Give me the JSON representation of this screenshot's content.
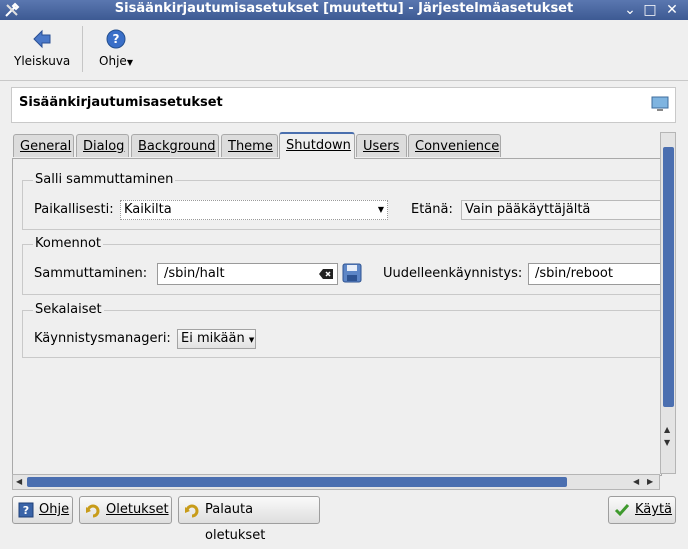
{
  "window": {
    "title": "Sisäänkirjautumisasetukset [muutettu] - Järjestelmäasetukset",
    "minimize_glyph": "⌄",
    "maximize_glyph": "□",
    "close_glyph": "✕"
  },
  "toolbar": {
    "overview_label": "Yleiskuva",
    "help_label": "Ohje"
  },
  "header": {
    "title": "Sisäänkirjautumisasetukset"
  },
  "tabs": [
    {
      "label": "General"
    },
    {
      "label": "Dialog"
    },
    {
      "label": "Background"
    },
    {
      "label": "Theme"
    },
    {
      "label": "Shutdown"
    },
    {
      "label": "Users"
    },
    {
      "label": "Convenience"
    }
  ],
  "active_tab": "Shutdown",
  "shutdown": {
    "allow_group_title": "Salli sammuttaminen",
    "local_label": "Paikallisesti:",
    "local_value": "Kaikilta",
    "remote_label": "Etänä:",
    "remote_value": "Vain pääkäyttäjältä",
    "commands_group_title": "Komennot",
    "halt_label": "Sammuttaminen:",
    "halt_value": "/sbin/halt",
    "reboot_label": "Uudelleenkäynnistys:",
    "reboot_value": "/sbin/reboot",
    "misc_group_title": "Sekalaiset",
    "bootmgr_label": "Käynnistysmanageri:",
    "bootmgr_value": "Ei mikään"
  },
  "buttons": {
    "help": "Ohje",
    "defaults": "Oletukset",
    "reset": "Palauta oletukset",
    "apply": "Käytä"
  },
  "colors": {
    "titlebar": "#4a6aa5",
    "accent": "#4b6fb0"
  }
}
